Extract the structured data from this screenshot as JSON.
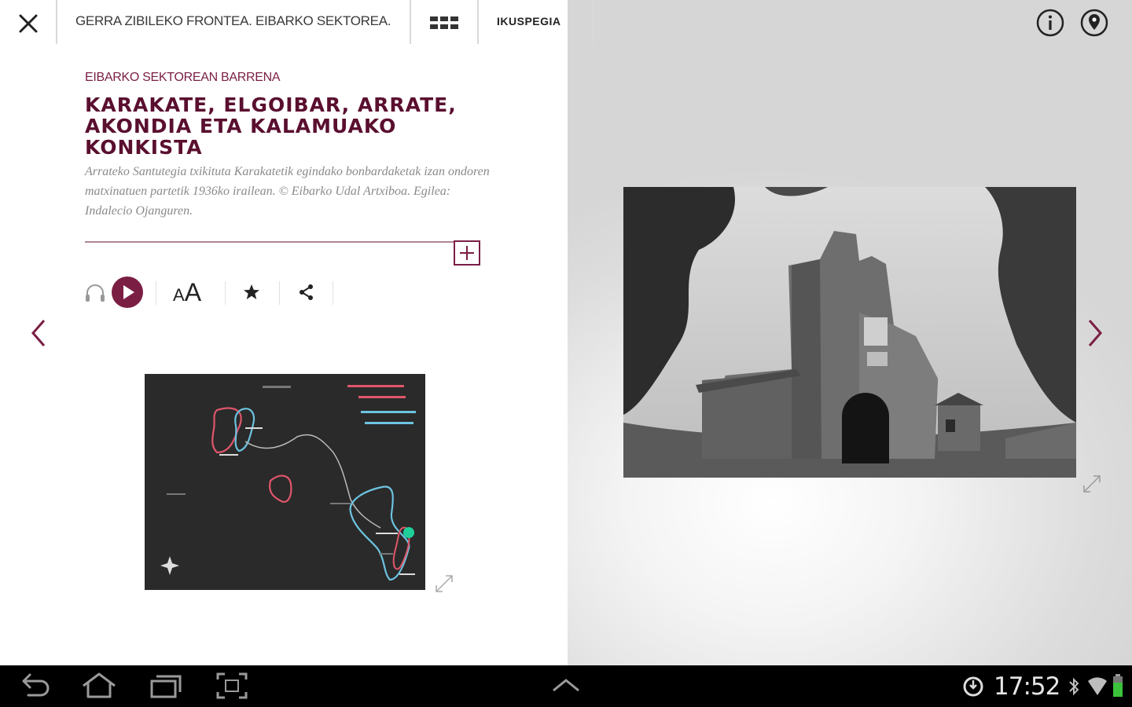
{
  "topbar": {
    "close_icon": "close-icon",
    "title": "GERRA ZIBILEKO FRONTEA. EIBARKO SEKTOREA.",
    "grid_icon": "grid-view-icon",
    "tab_label": "IKUSPEGIA",
    "info_icon": "info-icon",
    "location_icon": "location-pin-icon"
  },
  "article": {
    "kicker": "EIBARKO SEKTOREAN BARRENA",
    "title": "KARAKATE, ELGOIBAR, ARRATE, AKONDIA ETA KALAMUAKO KONKISTA",
    "caption": "Arrateko Santutegia txikituta Karakatetik egindako bonbardaketak izan ondoren matxinatuen partetik 1936ko irailean. © Eibarko Udal Artxiboa. Egilea: Indalecio Ojanguren.",
    "expand_icon": "plus-icon"
  },
  "tools": {
    "audio_icon": "headphones-icon",
    "play_icon": "play-icon",
    "font_size_label": "AA",
    "favorite_icon": "star-icon",
    "share_icon": "share-icon"
  },
  "navigation": {
    "prev_icon": "chevron-left-icon",
    "next_icon": "chevron-right-icon"
  },
  "colors": {
    "accent": "#7a1e44",
    "accent_dark": "#5a0f2f",
    "map_bg": "#2a2a2a",
    "route_red": "#e0566b",
    "route_blue": "#6cc3e0",
    "marker_green": "#1fcf9a"
  },
  "system_bar": {
    "time": "17:52",
    "back_icon": "back-icon",
    "home_icon": "home-icon",
    "recents_icon": "recent-apps-icon",
    "screenshot_icon": "screenshot-icon",
    "up_icon": "chevron-up-icon",
    "status_icons": [
      "sync-icon",
      "bluetooth-icon",
      "wifi-icon",
      "battery-icon"
    ]
  }
}
